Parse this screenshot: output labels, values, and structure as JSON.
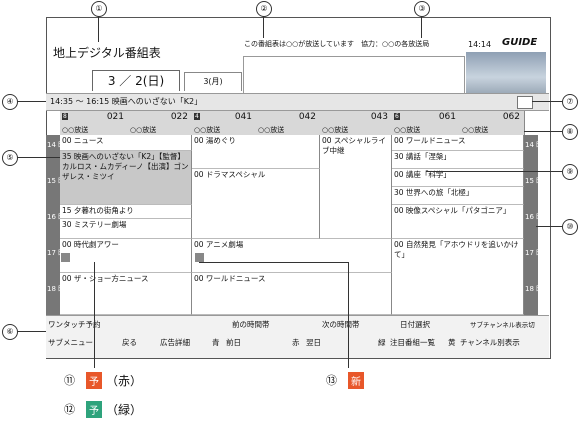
{
  "callouts": [
    "①",
    "②",
    "③",
    "④",
    "⑤",
    "⑥",
    "⑦",
    "⑧",
    "⑨",
    "⑩"
  ],
  "screen": {
    "title": "地上デジタル番組表",
    "notice": "この番組表は○○が放送しています　協力：○○の各放送局",
    "clock": "14:14",
    "logo": "GUIDE",
    "date_active": "3 ／ 2(日)",
    "date_next": "3(月)",
    "selected_program": "14:35 ～ 16:15  映画へのいざない「K2」"
  },
  "channels": [
    {
      "badge": "8",
      "num": "021",
      "name": "○○放送"
    },
    {
      "badge": "",
      "num": "022",
      "name": "○○放送"
    },
    {
      "badge": "4",
      "num": "041",
      "name": "○○放送"
    },
    {
      "badge": "",
      "num": "042",
      "name": "○○放送"
    },
    {
      "badge": "",
      "num": "043",
      "name": "○○放送"
    },
    {
      "badge": "6",
      "num": "061",
      "name": "○○放送"
    },
    {
      "badge": "",
      "num": "062",
      "name": "○○放送"
    }
  ],
  "hours": [
    "14\n時",
    "15\n時",
    "16\n時",
    "17\n時",
    "18\n時"
  ],
  "programs": {
    "col1": [
      "00 ニュース",
      "35 映画へのいざない「K2」【監督】カルロス・ムカディーノ【出演】ゴンザレス・ミツイ",
      "15 夕暮れの街角より",
      "30 ミステリー劇場",
      "00 時代劇アワー",
      "00 ザ・ショー方ニュース"
    ],
    "col2": [
      "00 湯めぐり",
      "00 ドラマスペシャル",
      "00 アニメ劇場",
      "00 ワールドニュース"
    ],
    "col3": [
      "00 スペシャルライブ中継"
    ],
    "col4": [
      "00 ワールドニュース",
      "30 講話「涅槃」",
      "00 講座「科学」",
      "30 世界への旅「北極」",
      "00 映像スペシャル「パタゴニア」",
      "00 自然発見「アホウドリを追いかけて」"
    ]
  },
  "footer": {
    "row1": [
      "ワンタッチ予約",
      "前の時間帯",
      "次の時間帯",
      "日付選択",
      "サブチャンネル表示切"
    ],
    "row2": [
      "サブメニュー",
      "戻る",
      "広告詳細",
      "前日",
      "翌日",
      "注目番組一覧",
      "チャンネル別表示"
    ],
    "color_keys": [
      "青",
      "赤",
      "緑",
      "黄"
    ]
  },
  "legend": [
    {
      "num": "⑪",
      "mark": "予",
      "color_name": "（赤）",
      "color": "#e8572a"
    },
    {
      "num": "⑫",
      "mark": "予",
      "color_name": "（緑）",
      "color": "#2ea37c"
    },
    {
      "num": "⑬",
      "mark": "新",
      "color_name": "",
      "color": "#e8572a"
    }
  ]
}
